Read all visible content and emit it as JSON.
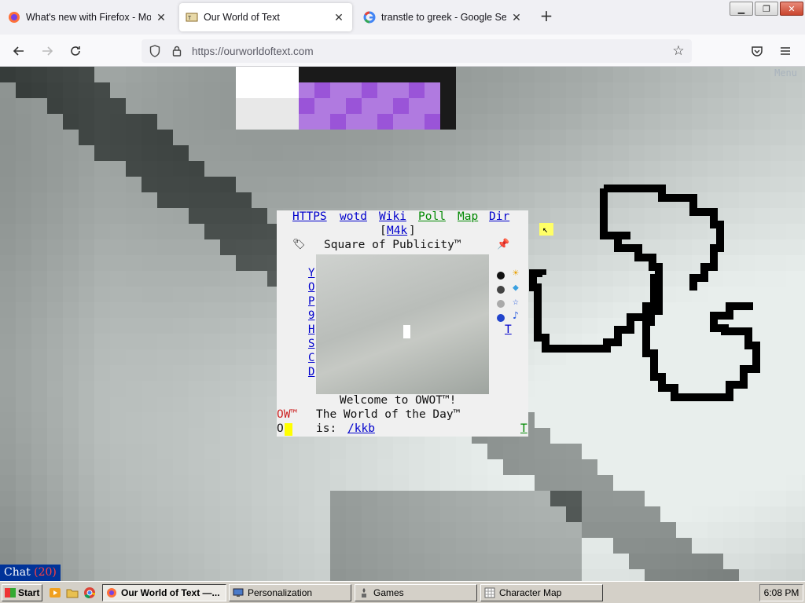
{
  "browser": {
    "tabs": [
      {
        "title": "What's new with Firefox - More",
        "icon": "firefox-icon",
        "active": false
      },
      {
        "title": "Our World of Text",
        "icon": "owot-icon",
        "active": true
      },
      {
        "title": "transtle to greek - Google Searc",
        "icon": "google-icon",
        "active": false
      }
    ],
    "new_tab_label": "+",
    "url": "https://ourworldoftext.com"
  },
  "owot": {
    "menu_label": "Menu",
    "nav_links": [
      "HTTPS",
      "wotd",
      "Wiki",
      "Poll",
      "Map",
      "Dir"
    ],
    "m4k": "M4k",
    "square_title": "Square of Publicity™",
    "side_letters": [
      "Y",
      "O",
      "P",
      "9",
      "H",
      "S",
      "C",
      "D"
    ],
    "right_t": "T",
    "welcome": "Welcome to OWOT™!",
    "wotd_line": "The World of the Day™",
    "is_label": "is:",
    "wotd_link": "/kkb",
    "ow_prefix": "OW™",
    "o_label": "O",
    "corner_t": "T",
    "chat_label": "Chat",
    "chat_count": "(20)"
  },
  "taskbar": {
    "start_label": "Start",
    "tasks": [
      {
        "label": "Our World of Text —...",
        "active": true
      },
      {
        "label": "Personalization",
        "active": false
      },
      {
        "label": "Games",
        "active": false
      },
      {
        "label": "Character Map",
        "active": false
      }
    ],
    "clock": "6:08 PM"
  },
  "colors": {
    "link_blue": "#0000cc",
    "link_green": "#008800",
    "chat_bg": "#003399",
    "chat_count": "#ff4040"
  }
}
